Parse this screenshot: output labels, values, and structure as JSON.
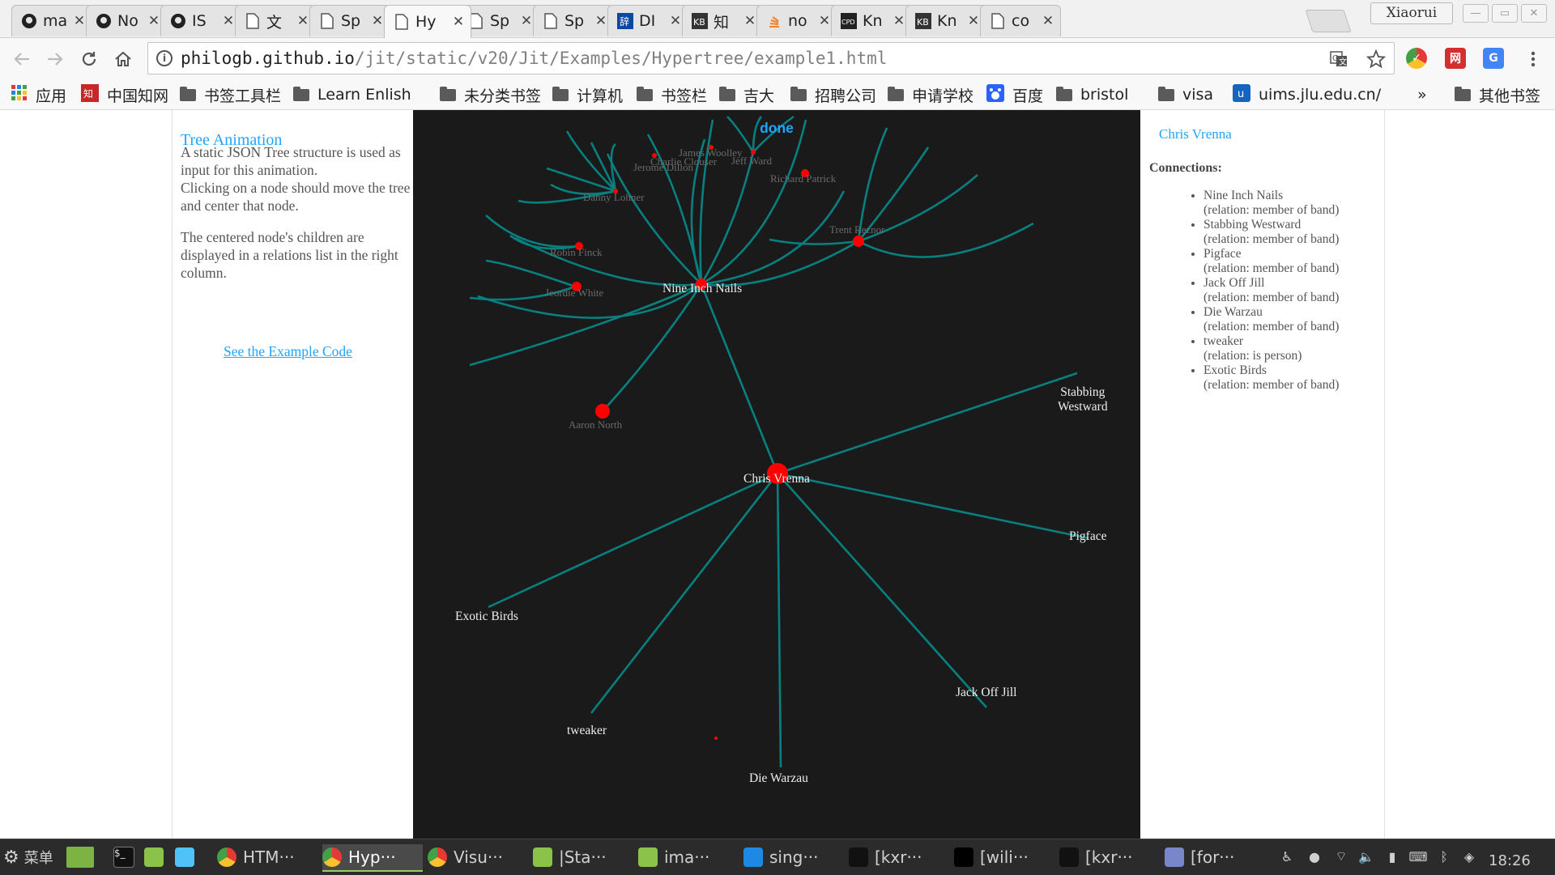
{
  "browser": {
    "tabs": [
      {
        "title": "ma",
        "icon": "github-icon"
      },
      {
        "title": "No",
        "icon": "github-icon"
      },
      {
        "title": "IS",
        "icon": "github-icon"
      },
      {
        "title": "文",
        "icon": "page-icon"
      },
      {
        "title": "Sp",
        "icon": "page-icon"
      },
      {
        "title": "Hy",
        "icon": "page-icon",
        "active": true
      },
      {
        "title": "Sp",
        "icon": "page-icon"
      },
      {
        "title": "Sp",
        "icon": "page-icon"
      },
      {
        "title": "DI",
        "icon": "dict-icon"
      },
      {
        "title": "知",
        "icon": "kb-icon"
      },
      {
        "title": "no",
        "icon": "stackoverflow-icon"
      },
      {
        "title": "Kn",
        "icon": "cpd-icon"
      },
      {
        "title": "Kn",
        "icon": "kb-icon"
      },
      {
        "title": "co",
        "icon": "page-icon"
      }
    ],
    "profile_name": "Xiaorui",
    "url_host": "philogb.github.io",
    "url_path": "/jit/static/v20/Jit/Examples/Hypertree/example1.html",
    "bookmarks": [
      {
        "label": "应用",
        "icon": "apps-grid-icon"
      },
      {
        "label": "中国知网",
        "icon": "cnki-icon"
      },
      {
        "label": "书签工具栏",
        "icon": "folder-icon"
      },
      {
        "label": "Learn Enlish",
        "icon": "folder-icon"
      },
      {
        "label": "未分类书签",
        "icon": "folder-icon"
      },
      {
        "label": "计算机",
        "icon": "folder-icon"
      },
      {
        "label": "书签栏",
        "icon": "folder-icon"
      },
      {
        "label": "吉大",
        "icon": "folder-icon"
      },
      {
        "label": "招聘公司",
        "icon": "folder-icon"
      },
      {
        "label": "申请学校",
        "icon": "folder-icon"
      },
      {
        "label": "百度",
        "icon": "baidu-icon"
      },
      {
        "label": "bristol",
        "icon": "folder-icon"
      },
      {
        "label": "visa",
        "icon": "folder-icon"
      },
      {
        "label": "uims.jlu.edu.cn/",
        "icon": "uims-icon"
      }
    ],
    "overflow_label": "»",
    "other_bookmarks": "其他书签"
  },
  "page": {
    "left": {
      "title": "Tree Animation",
      "p1": "A static JSON Tree structure is used as input for this animation.",
      "p2": "Clicking on a node should move the tree and center that node.",
      "p3": "The centered node's children are displayed in a relations list in the right column.",
      "link": "See the Example Code"
    },
    "log": "done",
    "labels": {
      "chris": "Chris Vrenna",
      "nin": "Nine Inch Nails",
      "stabbing": "Stabbing\nWestward",
      "pigface": "Pigface",
      "exotic": "Exotic Birds",
      "tweaker": "tweaker",
      "jackoff": "Jack Off Jill",
      "die": "Die Warzau",
      "aaron": "Aaron North",
      "jeordie": "Jeordie White",
      "robin": "Robin Finck",
      "danny": "Danny Lohner",
      "jerome": "Jerome Dillon",
      "charlie": "Charlie Clouser",
      "james": "James Woolley",
      "jeff": "Jeff Ward",
      "richard": "Richard Patrick",
      "trent": "Trent Reznor"
    },
    "right": {
      "node_name": "Chris Vrenna",
      "connections_title": "Connections:",
      "connections": [
        {
          "name": "Nine Inch Nails",
          "relation": "(relation: member of band)"
        },
        {
          "name": "Stabbing Westward",
          "relation": "(relation: member of band)"
        },
        {
          "name": "Pigface",
          "relation": "(relation: member of band)"
        },
        {
          "name": "Jack Off Jill",
          "relation": "(relation: member of band)"
        },
        {
          "name": "Die Warzau",
          "relation": "(relation: member of band)"
        },
        {
          "name": "tweaker",
          "relation": "(relation: is person)"
        },
        {
          "name": "Exotic Birds",
          "relation": "(relation: member of band)"
        }
      ]
    }
  },
  "colors": {
    "edge": "#088080",
    "node": "#ff0000",
    "canvas_bg": "#1a1a1a",
    "accent": "#23a4ff"
  },
  "taskbar": {
    "menu_label": "菜单",
    "items": [
      {
        "label": "HTM···",
        "icon": "chrome-icon"
      },
      {
        "label": "Hyp···",
        "icon": "chrome-icon",
        "active": true
      },
      {
        "label": "Visu···",
        "icon": "chrome-icon"
      },
      {
        "label": "|Sta···",
        "icon": "folder-icon"
      },
      {
        "label": "ima···",
        "icon": "folder-icon"
      },
      {
        "label": "sing···",
        "icon": "vscode-icon"
      },
      {
        "label": "[kxr···",
        "icon": "terminal-icon"
      },
      {
        "label": "[wili···",
        "icon": "webstorm-icon"
      },
      {
        "label": "[kxr···",
        "icon": "terminal-icon"
      },
      {
        "label": "[for···",
        "icon": "text-editor-icon"
      }
    ],
    "clock": "18:26"
  }
}
